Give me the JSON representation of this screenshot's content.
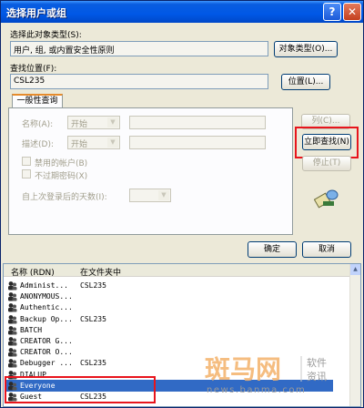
{
  "title": "选择用户或组",
  "title_buttons": {
    "help": "?",
    "close": "✕"
  },
  "object_type": {
    "label": "选择此对象类型(S):",
    "value": "用户, 组, 或内置安全性原则",
    "button": "对象类型(O)..."
  },
  "location": {
    "label": "查找位置(F):",
    "value": "CSL235",
    "button": "位置(L)..."
  },
  "tab": "一般性查询",
  "query": {
    "name_label": "名称(A):",
    "name_op": "开始",
    "desc_label": "描述(D):",
    "desc_op": "开始",
    "disabled_accounts": "禁用的帐户(B)",
    "never_expire": "不过期密码(X)",
    "days_label": "自上次登录后的天数(I):"
  },
  "side_buttons": {
    "columns": "列(C)...",
    "find_now": "立即查找(N)",
    "stop": "停止(T)"
  },
  "ok": "确定",
  "cancel": "取消",
  "results": {
    "columns": [
      "名称 (RDN)",
      "在文件夹中"
    ],
    "rows": [
      {
        "name": "Administ...",
        "folder": "CSL235"
      },
      {
        "name": "ANONYMOUS...",
        "folder": ""
      },
      {
        "name": "Authentic...",
        "folder": ""
      },
      {
        "name": "Backup Op...",
        "folder": "CSL235"
      },
      {
        "name": "BATCH",
        "folder": ""
      },
      {
        "name": "CREATOR G...",
        "folder": ""
      },
      {
        "name": "CREATOR O...",
        "folder": ""
      },
      {
        "name": "Debugger ...",
        "folder": "CSL235"
      },
      {
        "name": "DIALUP",
        "folder": ""
      },
      {
        "name": "Everyone",
        "folder": "",
        "selected": true
      },
      {
        "name": "Guest",
        "folder": "CSL235"
      }
    ]
  },
  "watermark": {
    "brand": "斑马网",
    "tag1": "软件",
    "tag2": "资讯",
    "url": "news.banma.com"
  },
  "colors": {
    "highlight": "#e8141c",
    "selection": "#316ac5",
    "title_bar": "#0058e6"
  }
}
